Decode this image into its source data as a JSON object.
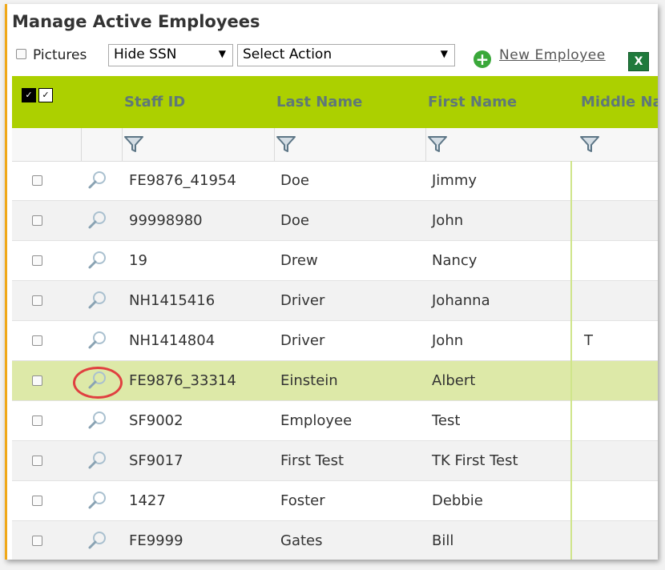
{
  "page": {
    "title": "Manage Active Employees"
  },
  "toolbar": {
    "pictures_label": "Pictures",
    "ssn_select": "Hide SSN",
    "action_select": "Select Action",
    "new_employee": "New Employee",
    "excel_icon": "excel-export-icon"
  },
  "columns": {
    "staff_id": "Staff ID",
    "last_name": "Last Name",
    "first_name": "First Name",
    "middle_name": "Middle Na"
  },
  "colors": {
    "header_bg": "#acd000",
    "selected_row": "#dde9a8",
    "accent_border": "#f0a818",
    "highlight": "#e04040"
  },
  "rows": [
    {
      "staff_id": "FE9876_41954",
      "last_name": "Doe",
      "first_name": "Jimmy",
      "middle": ""
    },
    {
      "staff_id": "99998980",
      "last_name": "Doe",
      "first_name": "John",
      "middle": ""
    },
    {
      "staff_id": "19",
      "last_name": "Drew",
      "first_name": "Nancy",
      "middle": ""
    },
    {
      "staff_id": "NH1415416",
      "last_name": "Driver",
      "first_name": "Johanna",
      "middle": ""
    },
    {
      "staff_id": "NH1414804",
      "last_name": "Driver",
      "first_name": "John",
      "middle": "T"
    },
    {
      "staff_id": "FE9876_33314",
      "last_name": "Einstein",
      "first_name": "Albert",
      "middle": "",
      "selected": true
    },
    {
      "staff_id": "SF9002",
      "last_name": "Employee",
      "first_name": "Test",
      "middle": ""
    },
    {
      "staff_id": "SF9017",
      "last_name": "First Test",
      "first_name": "TK First Test",
      "middle": ""
    },
    {
      "staff_id": "1427",
      "last_name": "Foster",
      "first_name": "Debbie",
      "middle": ""
    },
    {
      "staff_id": "FE9999",
      "last_name": "Gates",
      "first_name": "Bill",
      "middle": ""
    }
  ]
}
